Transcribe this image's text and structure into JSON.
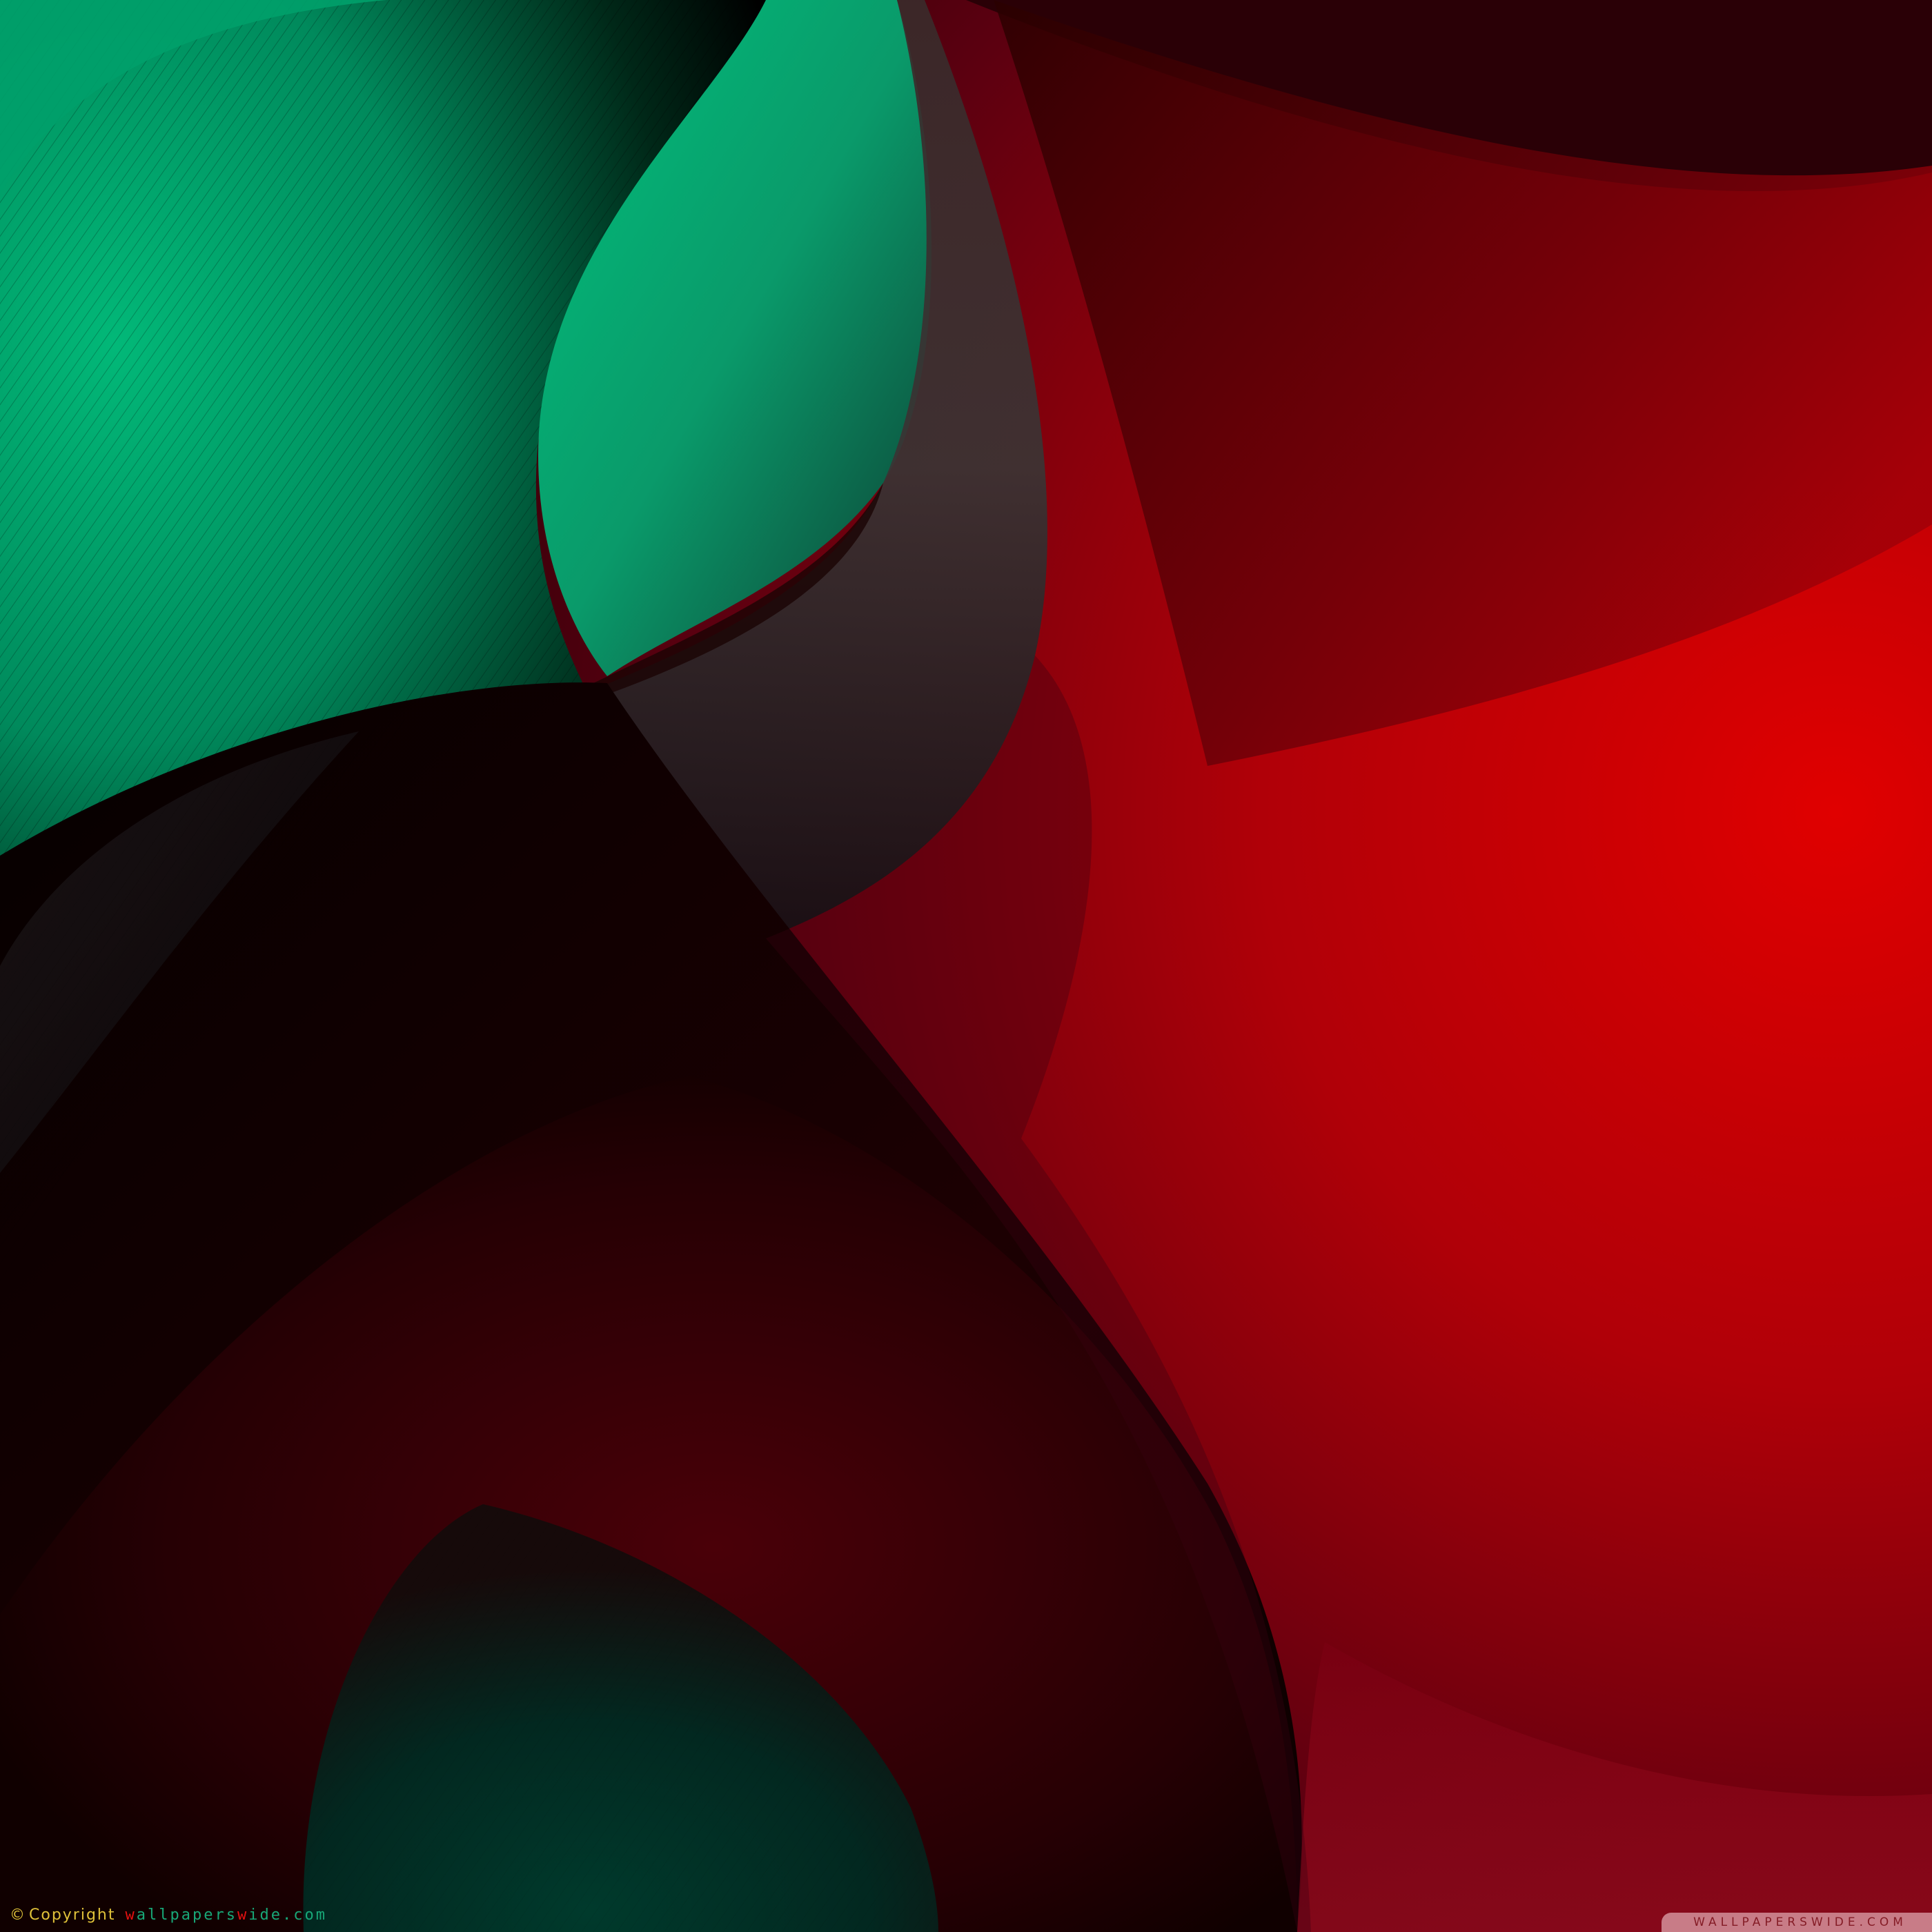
{
  "image": {
    "description_colors": {
      "green_light": "#00c07c",
      "green_dark": "#003028",
      "red_bright": "#e00000",
      "red_deep": "#5a0010",
      "near_black": "#0b0000"
    }
  },
  "copyright": {
    "symbol": "©",
    "word": "Copyright",
    "brand_parts": [
      "w",
      "allpaper",
      "s",
      "w",
      "ide.com"
    ],
    "brand_highlight_indexes": [
      0,
      3
    ]
  },
  "watermark": {
    "text": "WALLPAPERSWIDE.COM"
  }
}
